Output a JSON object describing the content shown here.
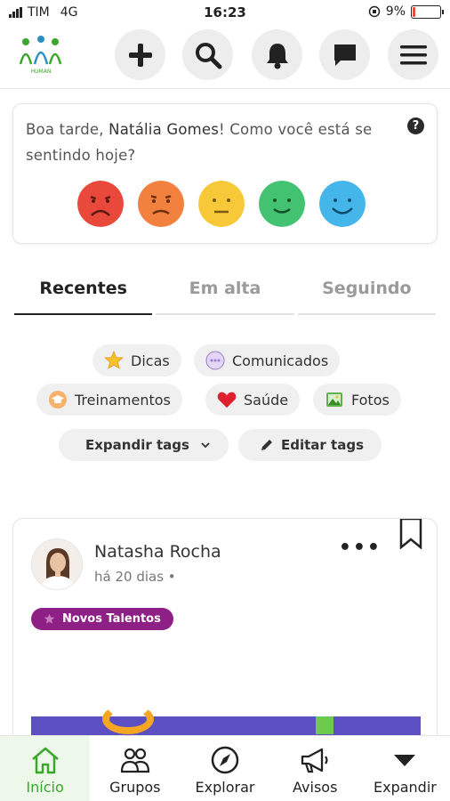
{
  "status_bar": {
    "carrier": "TIM",
    "network": "4G",
    "time": "16:23",
    "battery": "9%",
    "battery_level": 0.09
  },
  "header": {
    "logo_text": "HUMAN",
    "buttons": [
      {
        "icon": "plus-icon"
      },
      {
        "icon": "search-icon"
      },
      {
        "icon": "bell-icon"
      },
      {
        "icon": "chat-icon"
      },
      {
        "icon": "menu-icon"
      }
    ]
  },
  "mood": {
    "greeting_prefix": "Boa tarde, ",
    "user_name": "Natália Gomes",
    "greeting_suffix": "! Como você está se sentindo hoje?",
    "help": "?",
    "faces": [
      {
        "name": "very-sad",
        "color": "#e8493a"
      },
      {
        "name": "sad",
        "color": "#f2803e"
      },
      {
        "name": "neutral",
        "color": "#f7c938"
      },
      {
        "name": "happy",
        "color": "#43c271"
      },
      {
        "name": "very-happy",
        "color": "#44b6ea"
      }
    ]
  },
  "tabs": [
    {
      "label": "Recentes",
      "active": true
    },
    {
      "label": "Em alta",
      "active": false
    },
    {
      "label": "Seguindo",
      "active": false
    }
  ],
  "tags": {
    "dicas": "Dicas",
    "comunicados": "Comunicados",
    "treinamentos": "Treinamentos",
    "saude": "Saúde",
    "fotos": "Fotos",
    "expandir": "Expandir tags",
    "editar": "Editar tags"
  },
  "post": {
    "author": "Natasha Rocha",
    "time": "há 20 dias •",
    "more": "•••",
    "tag": "Novos Talentos"
  },
  "bottom_nav": [
    {
      "label": "Início",
      "icon": "home-icon",
      "active": true
    },
    {
      "label": "Grupos",
      "icon": "groups-icon",
      "active": false
    },
    {
      "label": "Explorar",
      "icon": "compass-icon",
      "active": false
    },
    {
      "label": "Avisos",
      "icon": "megaphone-icon",
      "active": false
    },
    {
      "label": "Expandir",
      "icon": "triangle-down-icon",
      "active": false
    }
  ],
  "colors": {
    "accent_green": "#3aa62b",
    "tag_purple": "#8e1f85"
  }
}
